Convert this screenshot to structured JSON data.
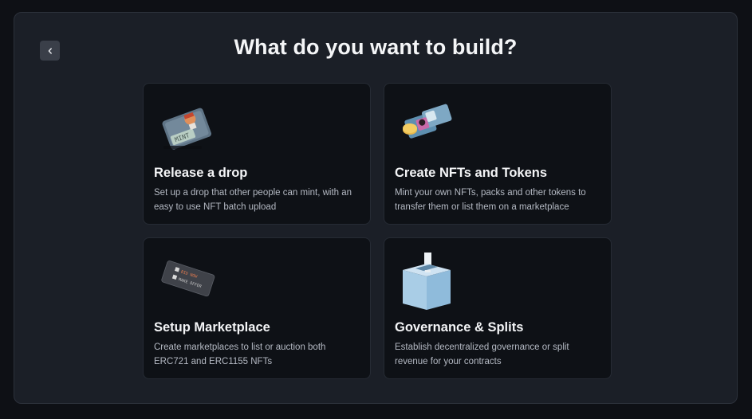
{
  "page": {
    "title": "What do you want to build?",
    "back_icon": "chevron-left-icon"
  },
  "cards": [
    {
      "title": "Release a drop",
      "description": "Set up a drop that other people can mint, with an easy to use NFT batch upload",
      "illustration_text": "MINT",
      "icon": "mint-card-illustration"
    },
    {
      "title": "Create NFTs and Tokens",
      "description": "Mint your own NFTs, packs and other tokens to transfer them or list them on a marketplace",
      "icon": "nft-tokens-illustration"
    },
    {
      "title": "Setup Marketplace",
      "description": "Create marketplaces to list or auction both ERC721 and ERC1155 NFTs",
      "illustration_labels": [
        "BID NOW",
        "MAKE OFFER"
      ],
      "icon": "marketplace-card-illustration"
    },
    {
      "title": "Governance & Splits",
      "description": "Establish decentralized governance or split revenue for your contracts",
      "icon": "ballot-box-illustration"
    }
  ],
  "colors": {
    "background": "#0e1015",
    "panel": "#1b1f27",
    "card": "#0e1116",
    "text": "#f4f5f7",
    "muted_text": "#b4b9c3"
  }
}
